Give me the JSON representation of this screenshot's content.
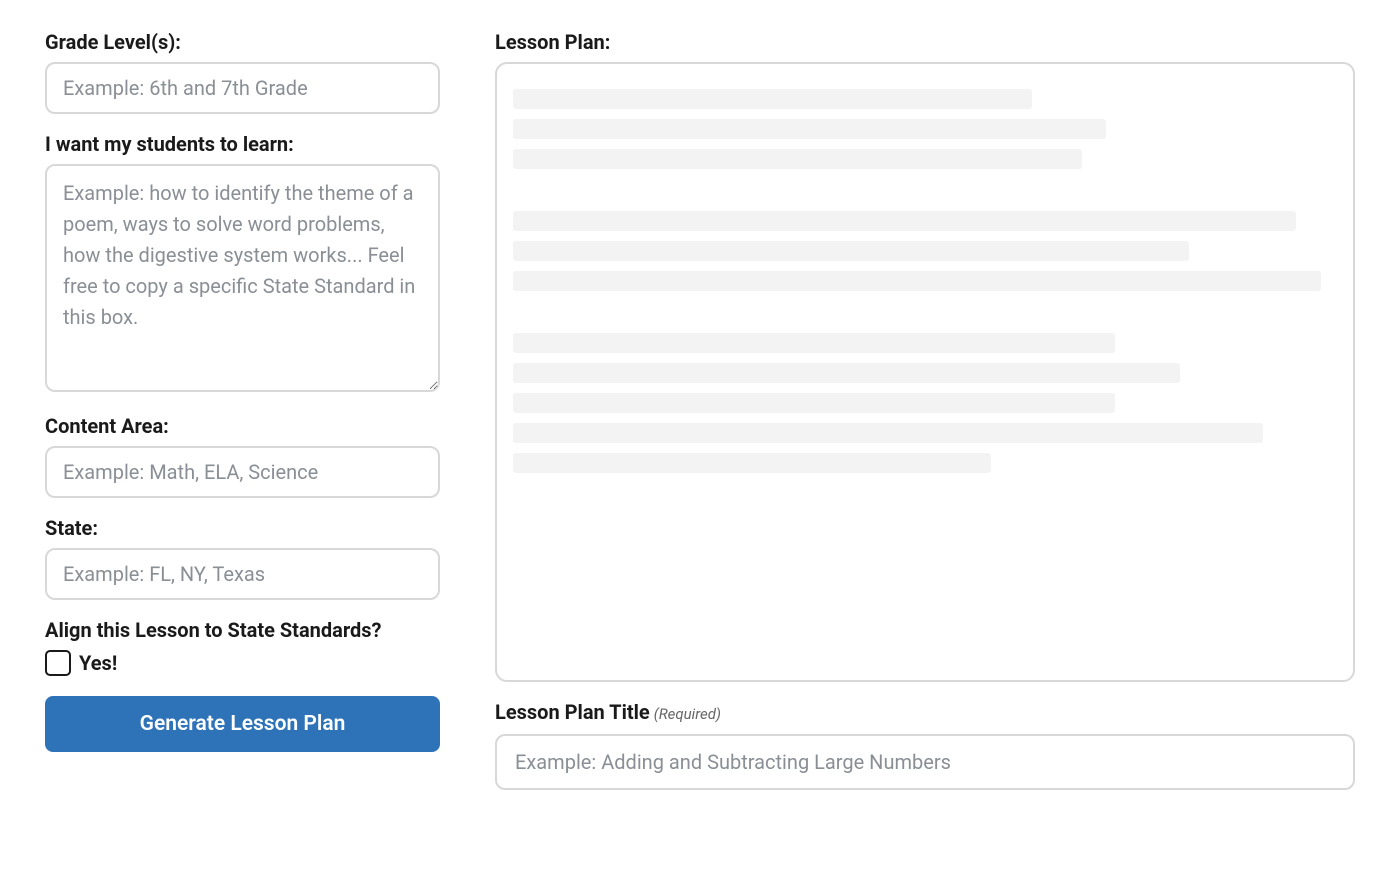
{
  "form": {
    "grade_level": {
      "label": "Grade Level(s):",
      "placeholder": "Example: 6th and 7th Grade",
      "value": ""
    },
    "learn": {
      "label": "I want my students to learn:",
      "placeholder": "Example: how to identify the theme of a poem, ways to solve word problems, how the digestive system works... Feel free to copy a specific State Standard in this box.",
      "value": ""
    },
    "content_area": {
      "label": "Content Area:",
      "placeholder": "Example: Math, ELA, Science",
      "value": ""
    },
    "state": {
      "label": "State:",
      "placeholder": "Example: FL, NY, Texas",
      "value": ""
    },
    "align_standards": {
      "label": "Align this Lesson to State Standards?",
      "checkbox_label": "Yes!",
      "checked": false
    },
    "generate_button": "Generate Lesson Plan"
  },
  "output": {
    "heading": "Lesson Plan:",
    "title_label": "Lesson Plan Title",
    "title_required": "(Required)",
    "title_placeholder": "Example: Adding and Subtracting Large Numbers",
    "title_value": ""
  }
}
